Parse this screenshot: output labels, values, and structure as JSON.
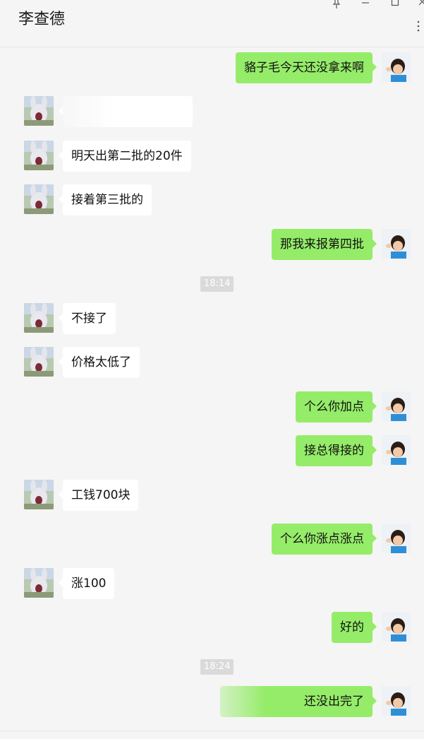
{
  "window": {
    "title": "李查德",
    "pin_icon": "pin-icon",
    "minimize_icon": "minimize-icon",
    "maximize_icon": "maximize-icon",
    "close_icon": "close-icon",
    "more_icon": "more-icon"
  },
  "colors": {
    "outgoing_bubble": "#95ec69",
    "incoming_bubble": "#ffffff",
    "background": "#f5f5f5",
    "timestamp_bg": "#dadada"
  },
  "messages": [
    {
      "side": "out",
      "text": "貉子毛今天还没拿来啊"
    },
    {
      "side": "in",
      "text": ""
    },
    {
      "side": "in",
      "text": "明天出第二批的20件"
    },
    {
      "side": "in",
      "text": "接着第三批的"
    },
    {
      "side": "out",
      "text": "那我来报第四批"
    },
    {
      "side": "time",
      "text": "18:14"
    },
    {
      "side": "in",
      "text": "不接了"
    },
    {
      "side": "in",
      "text": "价格太低了"
    },
    {
      "side": "out",
      "text": "个么你加点"
    },
    {
      "side": "out",
      "text": "接总得接的"
    },
    {
      "side": "in",
      "text": "工钱700块"
    },
    {
      "side": "out",
      "text": "个么你涨点涨点"
    },
    {
      "side": "in",
      "text": "涨100"
    },
    {
      "side": "out",
      "text": "好的"
    },
    {
      "side": "time",
      "text": "18:24"
    },
    {
      "side": "out",
      "text": "还没出完了"
    }
  ]
}
